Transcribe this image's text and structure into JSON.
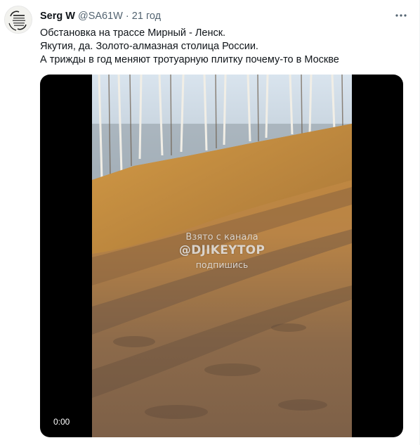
{
  "author": {
    "display_name": "Serg W",
    "handle": "@SA61W",
    "separator": "·",
    "time": "21 год",
    "avatar_icon": "user-avatar"
  },
  "tweet": {
    "lines": [
      "Обстановка на трассе Мирный - Ленск.",
      "Якутия, да. Золото-алмазная столица России.",
      "А трижды в год меняют тротуарную плитку почему-то в Москве"
    ]
  },
  "media": {
    "watermark_line1": "Взято с канала",
    "watermark_line2": "@DJIKEYTOP",
    "watermark_line3": "подпишись",
    "timestamp": "0:00"
  },
  "icons": {
    "more": "more-horizontal-icon"
  }
}
